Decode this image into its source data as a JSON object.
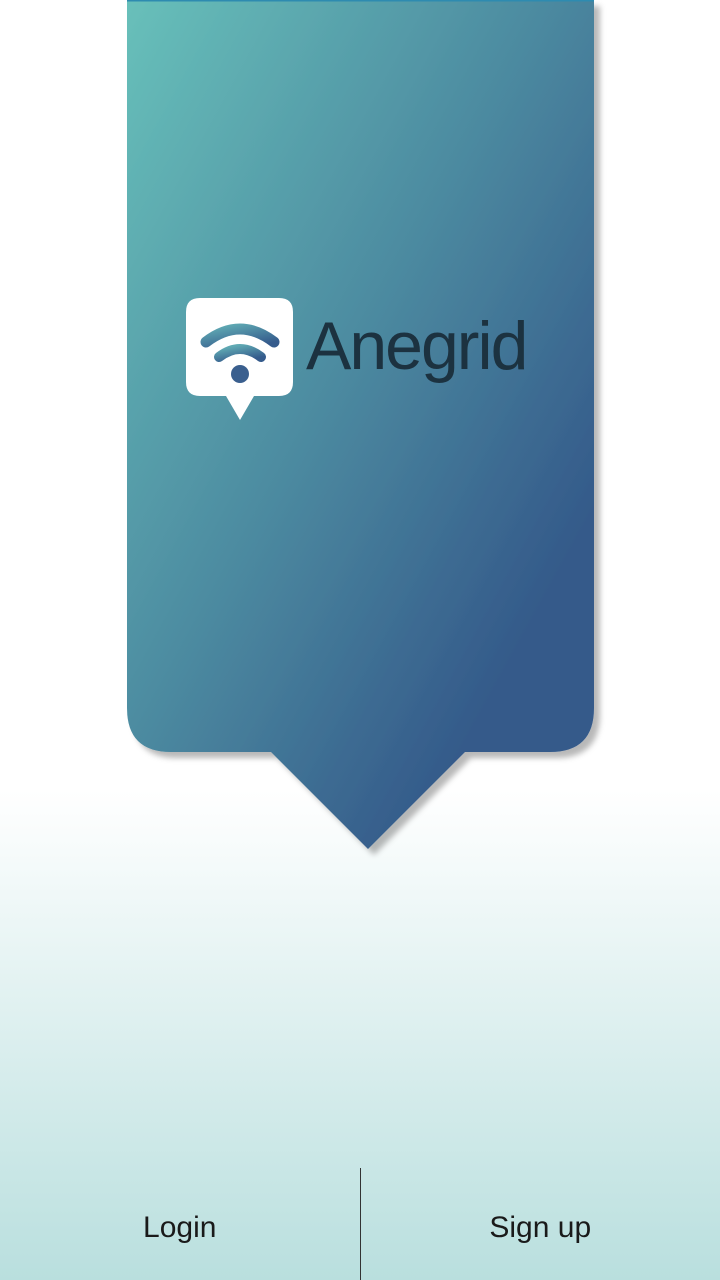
{
  "brand": {
    "name": "Anegrid",
    "icon": "wifi-pin-icon",
    "colors": {
      "banner_top": "#68c0ba",
      "banner_bottom": "#345a8a",
      "text": "#1c3240"
    }
  },
  "actions": {
    "login_label": "Login",
    "signup_label": "Sign up"
  },
  "background": {
    "bottom_color": "#b9dfde"
  }
}
